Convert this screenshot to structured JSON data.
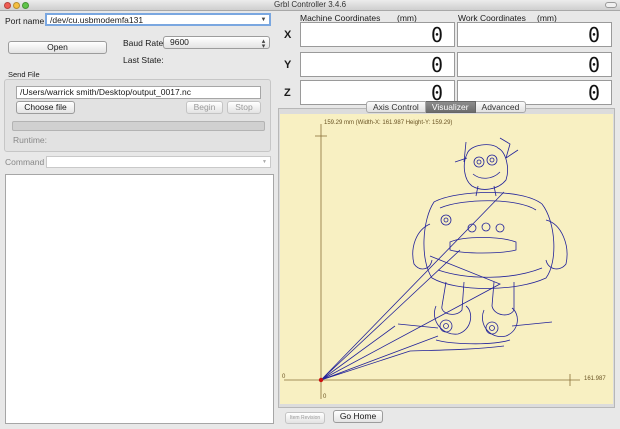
{
  "window": {
    "title": "Grbl Controller 3.4.6"
  },
  "connection": {
    "port_label": "Port name",
    "port_value": "/dev/cu.usbmodemfa131",
    "open_button": "Open",
    "baud_label": "Baud Rate",
    "baud_value": "9600",
    "last_state_label": "Last State:"
  },
  "send_file": {
    "group_label": "Send File",
    "path": "/Users/warrick smith/Desktop/output_0017.nc",
    "choose_button": "Choose file",
    "begin_button": "Begin",
    "stop_button": "Stop",
    "runtime_label": "Runtime:",
    "progress_fraction": 0
  },
  "command": {
    "label": "Command",
    "value": ""
  },
  "coordinates": {
    "machine_header": "Machine Coordinates",
    "work_header": "Work Coordinates",
    "unit": "(mm)",
    "axes": [
      {
        "letter": "X",
        "machine": "0",
        "work": "0"
      },
      {
        "letter": "Y",
        "machine": "0",
        "work": "0"
      },
      {
        "letter": "Z",
        "machine": "0",
        "work": "0"
      }
    ]
  },
  "tabs": [
    {
      "label": "Axis Control",
      "active": false
    },
    {
      "label": "Visualizer",
      "active": true
    },
    {
      "label": "Advanced",
      "active": false
    }
  ],
  "visualizer": {
    "info": "159.29 mm  (Width-X: 161.987  Height-Y: 159.29)",
    "x_origin_label": "0",
    "x_max_label": "161.987",
    "y_origin_label": "0",
    "bg_color": "#f8f0c2",
    "path_color": "#22229a",
    "axis_color": "#8a7038",
    "origin_color": "#cc1111"
  },
  "bottom_buttons": {
    "faint_button": "Item Revision",
    "go_home_button": "Go Home"
  }
}
